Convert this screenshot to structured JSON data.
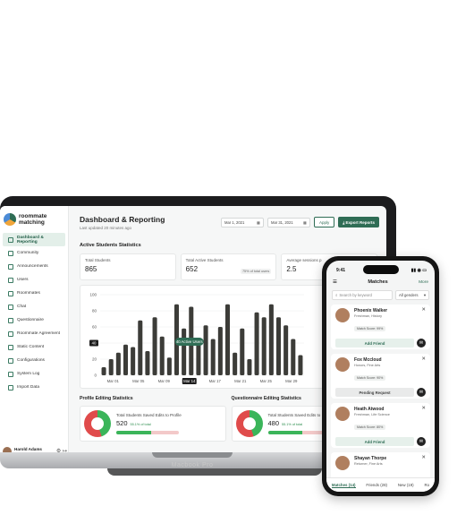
{
  "brand": {
    "line1": "roommate",
    "line2": "matching"
  },
  "sidebar": {
    "items": [
      {
        "label": "Dashboard & Reporting",
        "active": true
      },
      {
        "label": "Community"
      },
      {
        "label": "Announcements"
      },
      {
        "label": "Users"
      },
      {
        "label": "Roommates"
      },
      {
        "label": "Chat"
      },
      {
        "label": "Questionnaire"
      },
      {
        "label": "Roommate Agreement"
      },
      {
        "label": "Static Content"
      },
      {
        "label": "Configurations"
      },
      {
        "label": "System Log"
      },
      {
        "label": "Import Data"
      }
    ],
    "user": {
      "name": "Harold Adams",
      "role": "Super Admin"
    }
  },
  "header": {
    "title": "Dashboard & Reporting",
    "subtitle": "Last updated 20 minutes ago",
    "date_from": "Mar 1, 2021",
    "date_to": "Mar 31, 2021",
    "apply": "Apply",
    "export": "Export Reports"
  },
  "active_students": {
    "section_title": "Active Students Statistics",
    "stats": [
      {
        "label": "Total Students",
        "value": "865"
      },
      {
        "label": "Total Active Students",
        "value": "652",
        "badge": "75% of total users"
      },
      {
        "label": "Average sessions p",
        "value": "2.5"
      }
    ]
  },
  "chart_data": {
    "type": "bar",
    "yticks": [
      "100",
      "80",
      "60",
      "40",
      "20",
      "0"
    ],
    "ylim": [
      0,
      100
    ],
    "x_tick_labels": [
      "Mar 01",
      "Mar 05",
      "Mar 09",
      "Mar 14",
      "Mar 17",
      "Mar 21",
      "Mar 25",
      "Mar 29"
    ],
    "values": [
      10,
      20,
      28,
      38,
      35,
      68,
      30,
      72,
      48,
      22,
      88,
      58,
      85,
      38,
      62,
      45,
      60,
      88,
      28,
      58,
      20,
      78,
      72,
      88,
      72,
      62,
      45,
      25
    ],
    "tooltip": "40 Active Users",
    "highlight_tick": "Mar 14",
    "highlight_value": "40"
  },
  "profile_stats": {
    "title": "Profile Editing Statistics",
    "card_label": "Total Students Saved Edits to Profile",
    "value": "520",
    "pct": "55.1% of total",
    "share": 0.55
  },
  "questionnaire_stats": {
    "title": "Questionnaire Editing Statistics",
    "card_label": "Total Students Saved Edits to",
    "value": "480",
    "pct": "55.1% of total",
    "share": 0.55
  },
  "laptop_label": "Macbook Pro",
  "phone": {
    "time": "9:41",
    "title": "Matches",
    "more": "More",
    "search_placeholder": "Search by keyword",
    "gender_filter": "All genders",
    "matches": [
      {
        "name": "Phoenix Walker",
        "sub": "Freshman, History",
        "score": "Match Score: 99%",
        "action": "Add Friend"
      },
      {
        "name": "Fox Mccloud",
        "sub": "Honors, Fine Arts",
        "score": "Match Score: 90%",
        "action": "Pending Request"
      },
      {
        "name": "Heath Atwood",
        "sub": "Freshman, Life Science",
        "score": "Match Score: 80%",
        "action": "Add Friend"
      },
      {
        "name": "Shayan Thorpe",
        "sub": "Returner, Fine Arts",
        "score": "",
        "action": ""
      }
    ],
    "tabs": [
      "Matches (14)",
      "Friends (28)",
      "New (19)",
      "Ro"
    ]
  }
}
